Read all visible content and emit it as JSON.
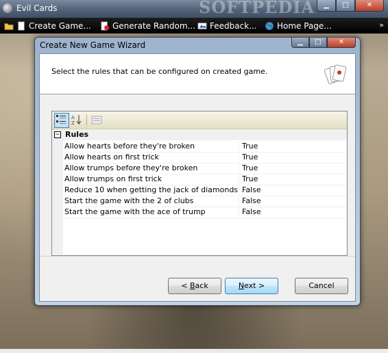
{
  "window": {
    "title": "Evil Cards",
    "watermark": "SOFTPEDIA",
    "caption_buttons": [
      "minimize",
      "maximize",
      "close"
    ]
  },
  "menubar": {
    "items": [
      {
        "label": "Create Game...",
        "icon": "folder-icon"
      },
      {
        "label": "Generate Random...",
        "icon": "random-icon"
      },
      {
        "label": "Feedback...",
        "icon": "feedback-icon"
      },
      {
        "label": "Home Page...",
        "icon": "globe-icon"
      }
    ],
    "overflow": "»"
  },
  "dialog": {
    "title": "Create New Game Wizard",
    "header_text": "Select the rules that can be configured on created game.",
    "header_icon": "cards-icon",
    "property_grid": {
      "toolbar": [
        "categorized-icon",
        "alphabetical-icon",
        "property-pages-icon"
      ],
      "category": {
        "expander": "⊟",
        "label": "Rules"
      },
      "rows": [
        {
          "name": "Allow hearts before they're broken",
          "value": "True"
        },
        {
          "name": "Allow hearts on first trick",
          "value": "True"
        },
        {
          "name": "Allow trumps before they're broken",
          "value": "True"
        },
        {
          "name": "Allow trumps on first trick",
          "value": "True"
        },
        {
          "name": "Reduce 10 when getting the jack of diamonds",
          "value": "False"
        },
        {
          "name": "Start the game with the 2 of clubs",
          "value": "False"
        },
        {
          "name": "Start the game with the ace of trump",
          "value": "False"
        }
      ]
    },
    "buttons": {
      "back": {
        "prefix": "< ",
        "mnemonic": "B",
        "rest": "ack"
      },
      "next": {
        "mnemonic": "N",
        "rest": "ext >"
      },
      "cancel": "Cancel"
    }
  }
}
